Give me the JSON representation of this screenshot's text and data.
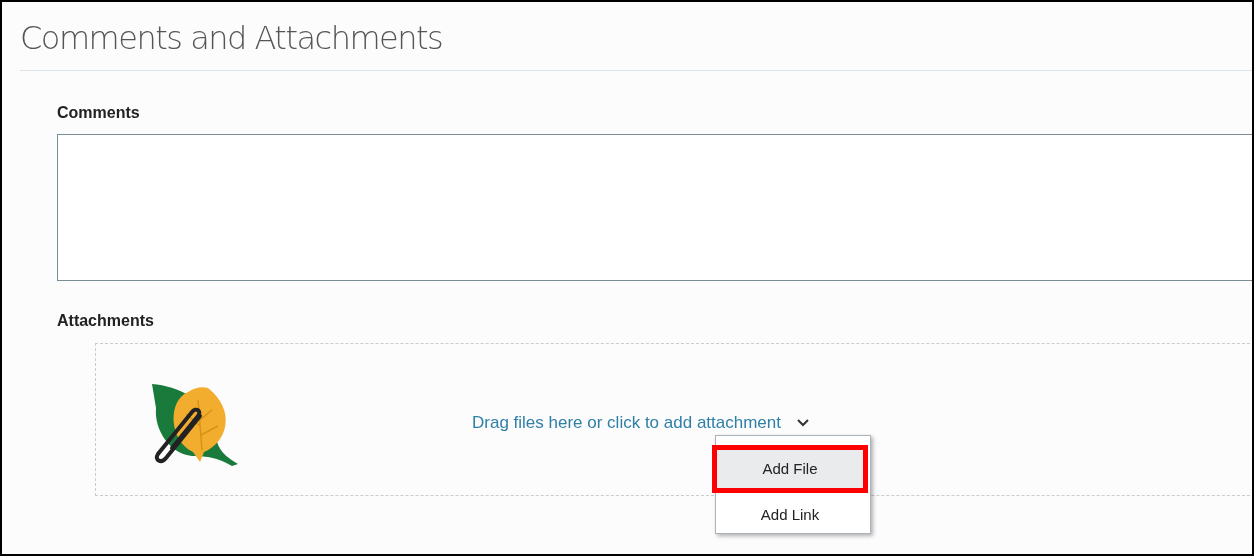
{
  "title": "Comments and Attachments",
  "comments": {
    "label": "Comments"
  },
  "attachments": {
    "label": "Attachments",
    "prompt": "Drag files here or click to add attachment",
    "expanded": true,
    "menu": [
      {
        "label": "Add File",
        "selected": true
      },
      {
        "label": "Add Link",
        "selected": false
      }
    ]
  }
}
